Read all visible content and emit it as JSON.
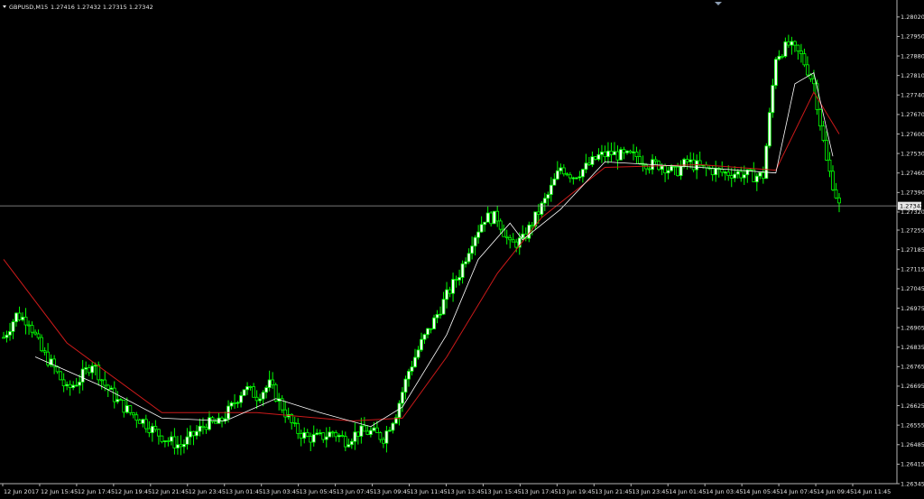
{
  "header": {
    "symbol": "GBPUSD,M15",
    "ohlc": "1.27416 1.27432 1.27315 1.27342"
  },
  "current_price_label": "1.27342",
  "colors": {
    "background": "#000000",
    "axis": "#b4b4b4",
    "bull_candle": "#00ff00",
    "bear_candle": "#00ff00",
    "bull_body": "#ffffff",
    "bear_body": "#000000",
    "ma_fast": "#ffffff",
    "ma_slow": "#cc1a1a",
    "price_line": "#a0a0a0"
  },
  "chart_data": {
    "type": "candlestick",
    "symbol": "GBPUSD",
    "timeframe": "M15",
    "grid": false,
    "y_axis_position": "right",
    "ylim": [
      1.26345,
      1.28055
    ],
    "y_ticks": [
      "1.28020",
      "1.27950",
      "1.27880",
      "1.27810",
      "1.27740",
      "1.27670",
      "1.27600",
      "1.27530",
      "1.27460",
      "1.27390",
      "1.27320",
      "1.27255",
      "1.27185",
      "1.27115",
      "1.27045",
      "1.26975",
      "1.26905",
      "1.26835",
      "1.26765",
      "1.26695",
      "1.26625",
      "1.26555",
      "1.26485",
      "1.26415",
      "1.26345"
    ],
    "x_ticks": [
      "12 Jun 2017",
      "12 Jun 15:45",
      "12 Jun 17:45",
      "12 Jun 19:45",
      "12 Jun 21:45",
      "12 Jun 23:45",
      "13 Jun 01:45",
      "13 Jun 03:45",
      "13 Jun 05:45",
      "13 Jun 07:45",
      "13 Jun 09:45",
      "13 Jun 11:45",
      "13 Jun 13:45",
      "13 Jun 15:45",
      "13 Jun 17:45",
      "13 Jun 19:45",
      "13 Jun 21:45",
      "13 Jun 23:45",
      "14 Jun 01:45",
      "14 Jun 03:45",
      "14 Jun 05:45",
      "14 Jun 07:45",
      "14 Jun 09:45",
      "14 Jun 11:45"
    ],
    "current_price": 1.27342,
    "close_path": [
      [
        0,
        1.2687
      ],
      [
        4,
        1.2695
      ],
      [
        8,
        1.2693
      ],
      [
        12,
        1.2682
      ],
      [
        16,
        1.2676
      ],
      [
        20,
        1.2668
      ],
      [
        24,
        1.2672
      ],
      [
        28,
        1.2678
      ],
      [
        32,
        1.267
      ],
      [
        36,
        1.2664
      ],
      [
        40,
        1.266
      ],
      [
        44,
        1.2657
      ],
      [
        48,
        1.2653
      ],
      [
        52,
        1.265
      ],
      [
        56,
        1.2648
      ],
      [
        60,
        1.2652
      ],
      [
        64,
        1.2656
      ],
      [
        68,
        1.2656
      ],
      [
        72,
        1.2662
      ],
      [
        76,
        1.2669
      ],
      [
        80,
        1.2666
      ],
      [
        84,
        1.267
      ],
      [
        88,
        1.2662
      ],
      [
        92,
        1.2654
      ],
      [
        96,
        1.2651
      ],
      [
        100,
        1.2651
      ],
      [
        104,
        1.2653
      ],
      [
        108,
        1.265
      ],
      [
        112,
        1.2653
      ],
      [
        116,
        1.2653
      ],
      [
        120,
        1.2651
      ],
      [
        124,
        1.266
      ],
      [
        128,
        1.2675
      ],
      [
        132,
        1.2685
      ],
      [
        136,
        1.2693
      ],
      [
        140,
        1.2702
      ],
      [
        144,
        1.271
      ],
      [
        148,
        1.2722
      ],
      [
        152,
        1.273
      ],
      [
        156,
        1.273
      ],
      [
        160,
        1.272
      ],
      [
        164,
        1.2722
      ],
      [
        168,
        1.273
      ],
      [
        172,
        1.2738
      ],
      [
        176,
        1.2748
      ],
      [
        180,
        1.2745
      ],
      [
        184,
        1.2748
      ],
      [
        188,
        1.2752
      ],
      [
        192,
        1.2753
      ],
      [
        196,
        1.2752
      ],
      [
        200,
        1.2752
      ],
      [
        204,
        1.2749
      ],
      [
        208,
        1.2749
      ],
      [
        212,
        1.2746
      ],
      [
        216,
        1.275
      ],
      [
        220,
        1.2748
      ],
      [
        224,
        1.2747
      ],
      [
        228,
        1.2746
      ],
      [
        232,
        1.2746
      ],
      [
        236,
        1.2745
      ],
      [
        240,
        1.2745
      ],
      [
        244,
        1.2788
      ],
      [
        248,
        1.2792
      ],
      [
        252,
        1.2788
      ],
      [
        256,
        1.2778
      ],
      [
        260,
        1.275
      ],
      [
        264,
        1.27342
      ]
    ],
    "ma_fast_path": [
      [
        10,
        1.268
      ],
      [
        30,
        1.267
      ],
      [
        50,
        1.2658
      ],
      [
        70,
        1.2657
      ],
      [
        86,
        1.2665
      ],
      [
        100,
        1.266
      ],
      [
        116,
        1.2655
      ],
      [
        126,
        1.2662
      ],
      [
        140,
        1.2688
      ],
      [
        150,
        1.2715
      ],
      [
        160,
        1.2728
      ],
      [
        164,
        1.2722
      ],
      [
        176,
        1.2733
      ],
      [
        190,
        1.275
      ],
      [
        220,
        1.2748
      ],
      [
        244,
        1.2746
      ],
      [
        250,
        1.2778
      ],
      [
        256,
        1.2782
      ],
      [
        262,
        1.2752
      ]
    ],
    "ma_slow_path": [
      [
        0,
        1.2715
      ],
      [
        20,
        1.2685
      ],
      [
        50,
        1.266
      ],
      [
        80,
        1.266
      ],
      [
        110,
        1.2657
      ],
      [
        126,
        1.2658
      ],
      [
        140,
        1.268
      ],
      [
        156,
        1.271
      ],
      [
        170,
        1.273
      ],
      [
        190,
        1.2748
      ],
      [
        220,
        1.2749
      ],
      [
        244,
        1.2747
      ],
      [
        256,
        1.2775
      ],
      [
        264,
        1.276
      ]
    ]
  }
}
